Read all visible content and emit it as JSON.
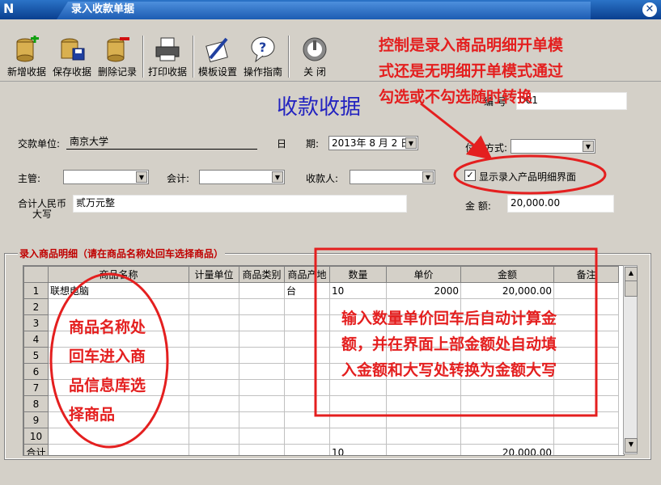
{
  "window": {
    "title": "录入收款单据",
    "app_icon_text": "N",
    "close_glyph": "✕"
  },
  "toolbar": {
    "new_label": "新增收据",
    "save_label": "保存收据",
    "delete_label": "删除记录",
    "print_label": "打印收据",
    "template_label": "模板设置",
    "help_label": "操作指南",
    "close_label": "关 闭"
  },
  "form": {
    "title": "收款收据",
    "number_label": "编 号",
    "number_value": "001",
    "payer_label": "交款单位:",
    "payer_value": "南京大学",
    "date_label_1": "日",
    "date_label_2": "期:",
    "date_value": "2013年 8 月 2 日",
    "payment_label": "付款方式:",
    "payment_value": "",
    "supervisor_label": "主管:",
    "accountant_label": "会计:",
    "receiver_label": "收款人:",
    "show_detail_label": "显示录入产品明细界面",
    "show_detail_checked": true,
    "capital_label_1": "合计人民币",
    "capital_label_2": "大写",
    "capital_value": "贰万元整",
    "amount_label": "金  额:",
    "amount_value": "20,000.00"
  },
  "detail": {
    "group_title": "录入商品明细（请在商品名称处回车选择商品）",
    "columns": [
      "商品名称",
      "计量单位",
      "商品类别",
      "商品产地",
      "数量",
      "单价",
      "金额",
      "备注"
    ],
    "rows": [
      {
        "no": "1",
        "name": "联想电脑",
        "unit": "",
        "category": "",
        "origin": "台",
        "qty": "10",
        "price": "2000",
        "amount": "20,000.00",
        "note": ""
      },
      {
        "no": "2"
      },
      {
        "no": "3"
      },
      {
        "no": "4"
      },
      {
        "no": "5"
      },
      {
        "no": "6"
      },
      {
        "no": "7"
      },
      {
        "no": "8"
      },
      {
        "no": "9"
      },
      {
        "no": "10"
      }
    ],
    "total_label": "合计",
    "total_qty": "10",
    "total_amount": "20,000.00"
  },
  "annotations": {
    "top_right": [
      "控制是录入商品明细开单模",
      "式还是无明细开单模式通过",
      "勾选或不勾选随时转换"
    ],
    "left": [
      "商品名称处",
      "回车进入商",
      "品信息库选",
      "择商品"
    ],
    "right": [
      "输入数量单价回车后自动计算金",
      "额，并在界面上部金额处自动填",
      "入金额和大写处转换为金额大写"
    ]
  },
  "colors": {
    "annotation": "#e41f1f",
    "title_blue": "#2323c0",
    "titlebar": "#0a3f8f"
  }
}
